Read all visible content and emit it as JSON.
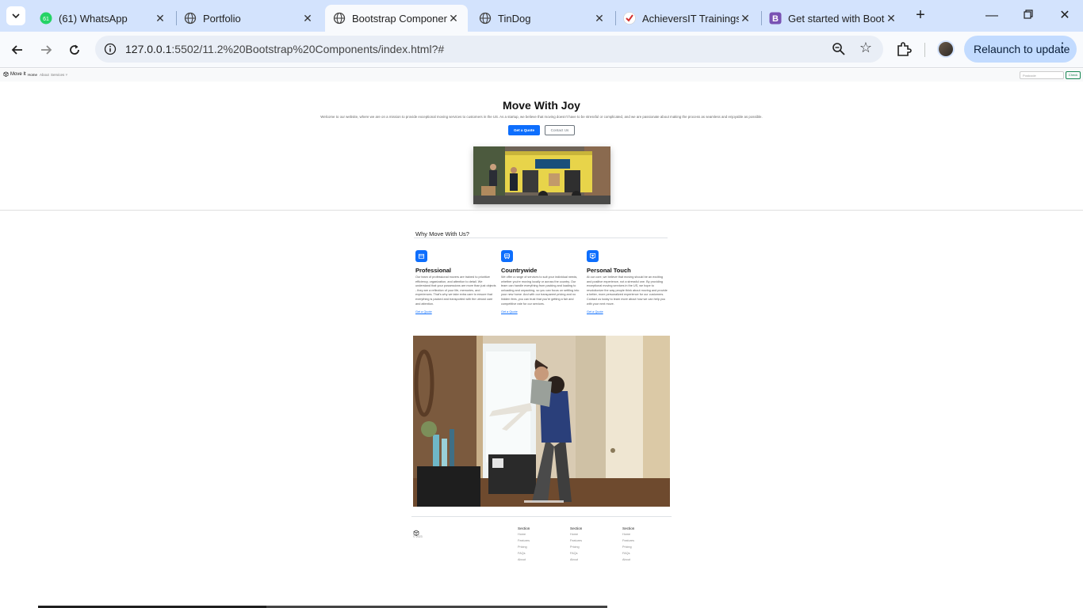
{
  "browser": {
    "tabs": [
      {
        "title": "(61) WhatsApp",
        "badge": "61"
      },
      {
        "title": "Portfolio"
      },
      {
        "title": "Bootstrap Components",
        "active": true
      },
      {
        "title": "TinDog"
      },
      {
        "title": "AchieversIT Trainings"
      },
      {
        "title": "Get started with Bootstrap",
        "badge": "B"
      }
    ],
    "url_host": "127.0.0.1",
    "url_path": ":5502/11.2%20Bootstrap%20Components/index.html?#",
    "relaunch_label": "Relaunch to update"
  },
  "navbar": {
    "brand": "Move It",
    "links": [
      "Home",
      "About",
      "Services ˅"
    ],
    "search_placeholder": "Postcode",
    "check_label": "Check"
  },
  "hero": {
    "title": "Move With Joy",
    "text": "Welcome to our website, where we are on a mission to provide exceptional moving services to customers in the US. As a startup, we believe that moving doesn't have to be stressful or complicated, and we are passionate about making the process as seamless and enjoyable as possible.",
    "primary_button": "Get a Quote",
    "secondary_button": "Contact Us"
  },
  "features": {
    "heading": "Why Move With Us?",
    "items": [
      {
        "title": "Professional",
        "icon": "box-icon",
        "text": "Our team of professional movers are trained to prioritize efficiency, organization, and attention to detail. We understand that your possessions are more than just objects - they are a reflection of your life, memories, and experiences. That's why we take extra care to ensure that everything is packed and transported with the utmost care and attention.",
        "link": "Get a Quote"
      },
      {
        "title": "Countrywide",
        "icon": "truck-icon",
        "text": "We offer a range of services to suit your individual needs, whether you're moving locally or across the country. Our team can handle everything from packing and loading to unloading and unpacking, so you can focus on settling into your new home. And with our transparent pricing and no hidden fees, you can trust that you're getting a fair and competitive rate for our services.",
        "link": "Get a Quote"
      },
      {
        "title": "Personal Touch",
        "icon": "heart-icon",
        "text": "At our core, we believe that moving should be an exciting and positive experience, not a stressful one. By providing exceptional moving services in the US, we hope to revolutionize the way people think about moving and provide a better, more personalized experience for our customers. Contact us today to learn more about how we can help you with your next move.",
        "link": "Get a Quote"
      }
    ]
  },
  "footer": {
    "copyright": "© 2023",
    "columns": [
      {
        "heading": "Section",
        "items": [
          "Home",
          "Features",
          "Pricing",
          "FAQs",
          "About"
        ]
      },
      {
        "heading": "Section",
        "items": [
          "Home",
          "Features",
          "Pricing",
          "FAQs",
          "About"
        ]
      },
      {
        "heading": "Section",
        "items": [
          "Home",
          "Features",
          "Pricing",
          "FAQs",
          "About"
        ]
      }
    ]
  },
  "colors": {
    "primary": "#0d6efd",
    "tabstrip": "#d3e3fd",
    "relaunch": "#c2dbff"
  }
}
